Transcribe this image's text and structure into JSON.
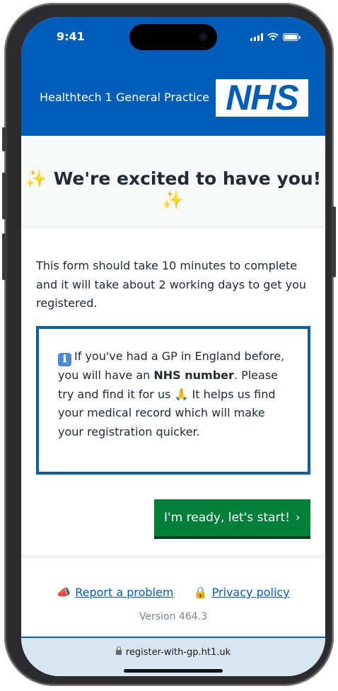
{
  "status_bar": {
    "time": "9:41",
    "battery_level": 1.0
  },
  "header": {
    "practice_name": "Healthtech 1 General Practice",
    "logo_text": "NHS",
    "background_color": "#005eb8"
  },
  "welcome": {
    "sparkle_left": "✨",
    "title": "We're excited to have you!",
    "sparkle_right": "✨"
  },
  "intro": {
    "text": "This form should take 10 minutes to complete and it will take about 2 working days to get you registered."
  },
  "info_box": {
    "icon": "ℹ",
    "text_before": "If you've had a GP in England before, you will have an ",
    "emphasis": "NHS number",
    "text_after": ". Please try and find it for us ",
    "pray_icon": "🙏",
    "text_end": " It helps us find your medical record which will make your registration quicker."
  },
  "start_button": {
    "label": "I'm ready, let's start!",
    "chevron": "›",
    "color": "#007f3b"
  },
  "footer": {
    "report_icon": "📣",
    "report_label": "Report a problem",
    "privacy_icon": "🔒",
    "privacy_label": "Privacy policy",
    "version": "Version 464.3"
  },
  "browser": {
    "url": "register-with-gp.ht1.uk"
  }
}
